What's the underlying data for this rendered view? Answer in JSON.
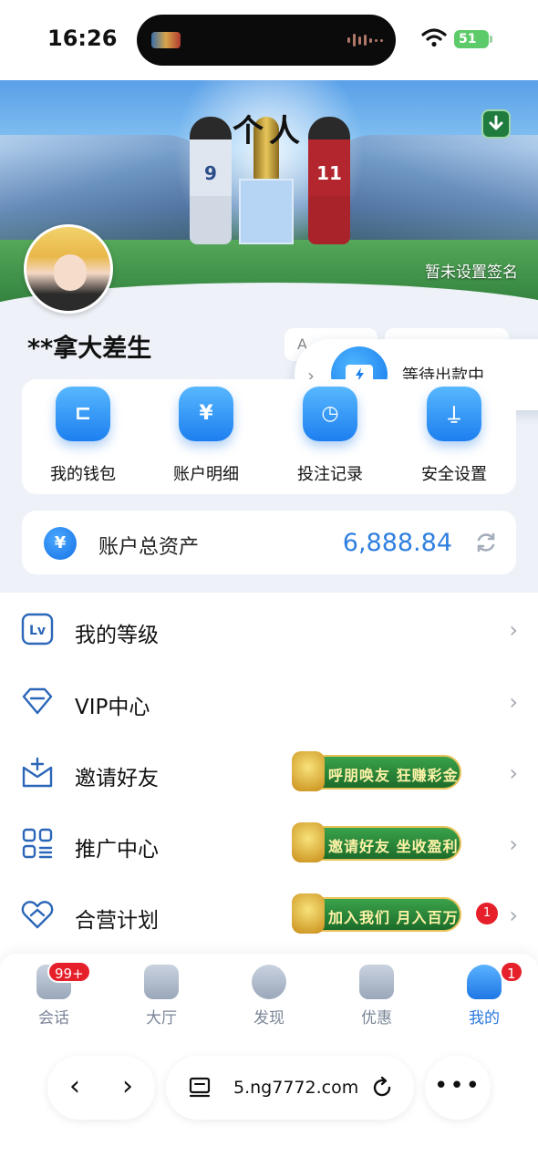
{
  "status_bar": {
    "time": "16:26",
    "battery": "51"
  },
  "banner": {
    "title": "个人",
    "signature": "暂未设置签名",
    "jersey_left": "9",
    "jersey_right": "11"
  },
  "profile": {
    "username": "**拿大差生",
    "chip_1": "A",
    "chip_2": ""
  },
  "toast": {
    "text": "等待出款中"
  },
  "actions": [
    {
      "label": "我的钱包",
      "icon": "wallet-icon"
    },
    {
      "label": "账户明细",
      "icon": "yen-icon"
    },
    {
      "label": "投注记录",
      "icon": "bet-record-icon"
    },
    {
      "label": "安全设置",
      "icon": "security-icon"
    }
  ],
  "assets": {
    "label": "账户总资产",
    "value": "6,888.84",
    "currency_symbol": "¥"
  },
  "menu": [
    {
      "label": "我的等级",
      "icon": "level-icon"
    },
    {
      "label": "VIP中心",
      "icon": "diamond-icon"
    },
    {
      "label": "邀请好友",
      "icon": "invite-icon",
      "promo": "呼朋唤友 狂赚彩金"
    },
    {
      "label": "推广中心",
      "icon": "grid-icon",
      "promo": "邀请好友 坐收盈利"
    },
    {
      "label": "合营计划",
      "icon": "handshake-icon",
      "promo": "加入我们 月入百万",
      "badge": "1"
    }
  ],
  "tabs": [
    {
      "label": "会话",
      "badge": "99+"
    },
    {
      "label": "大厅"
    },
    {
      "label": "发现"
    },
    {
      "label": "优惠"
    },
    {
      "label": "我的",
      "badge": "1",
      "active": true
    }
  ],
  "browser": {
    "url": "5.ng7772.com",
    "back": "‹",
    "forward": "›",
    "more": "•••"
  },
  "colors": {
    "accent": "#2f7fe0",
    "badge_red": "#e5202b"
  }
}
